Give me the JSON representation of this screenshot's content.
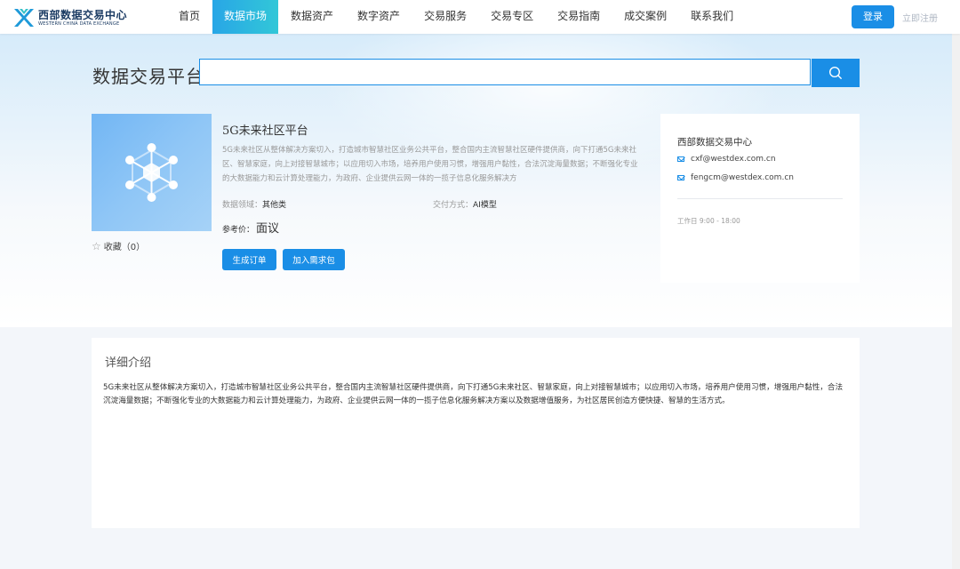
{
  "header": {
    "logo_cn": "西部数据交易中心",
    "logo_en": "WESTERN CHINA DATA EXCHANGE",
    "nav": [
      {
        "label": "首页",
        "active": false
      },
      {
        "label": "数据市场",
        "active": true
      },
      {
        "label": "数据资产",
        "active": false
      },
      {
        "label": "数字资产",
        "active": false
      },
      {
        "label": "交易服务",
        "active": false
      },
      {
        "label": "交易专区",
        "active": false
      },
      {
        "label": "交易指南",
        "active": false
      },
      {
        "label": "成交案例",
        "active": false
      },
      {
        "label": "联系我们",
        "active": false
      }
    ],
    "login_label": "登录",
    "register_label": "立即注册"
  },
  "search": {
    "title": "数据交易平台",
    "value": "",
    "icon": "search-icon"
  },
  "product": {
    "title": "5G未来社区平台",
    "description": "5G未来社区从整体解决方案切入，打造城市智慧社区业务公共平台，整合国内主流智慧社区硬件提供商，向下打通5G未来社区、智慧家庭，向上对接智慧城市；以应用切入市场，培养用户使用习惯，增强用户黏性，合法沉淀海量数据；不断强化专业的大数据能力和云计算处理能力，为政府、企业提供云网一体的一揽子信息化服务解决方",
    "domain_label": "数据领域：",
    "domain_value": "其他类",
    "delivery_label": "交付方式：",
    "delivery_value": "AI模型",
    "price_label": "参考价：",
    "price_value": "面议",
    "favorite_label": "收藏（0）",
    "order_button": "生成订单",
    "demand_button": "加入需求包"
  },
  "contact": {
    "org": "西部数据交易中心",
    "emails": [
      "cxf@westdex.com.cn",
      "fengcm@westdex.com.cn"
    ],
    "work_hours": "工作日 9:00 - 18:00"
  },
  "detail": {
    "title": "详细介绍",
    "text": "5G未来社区从整体解决方案切入，打造城市智慧社区业务公共平台，整合国内主流智慧社区硬件提供商，向下打通5G未来社区、智慧家庭，向上对接智慧城市；以应用切入市场，培养用户使用习惯，增强用户黏性，合法沉淀海量数据；不断强化专业的大数据能力和云计算处理能力，为政府、企业提供云网一体的一揽子信息化服务解决方案以及数据增值服务，为社区居民创造方便快捷、智慧的生活方式。"
  },
  "colors": {
    "accent": "#1a8ee6",
    "nav_active_start": "#28a6e6",
    "nav_active_end": "#32c7d8"
  }
}
